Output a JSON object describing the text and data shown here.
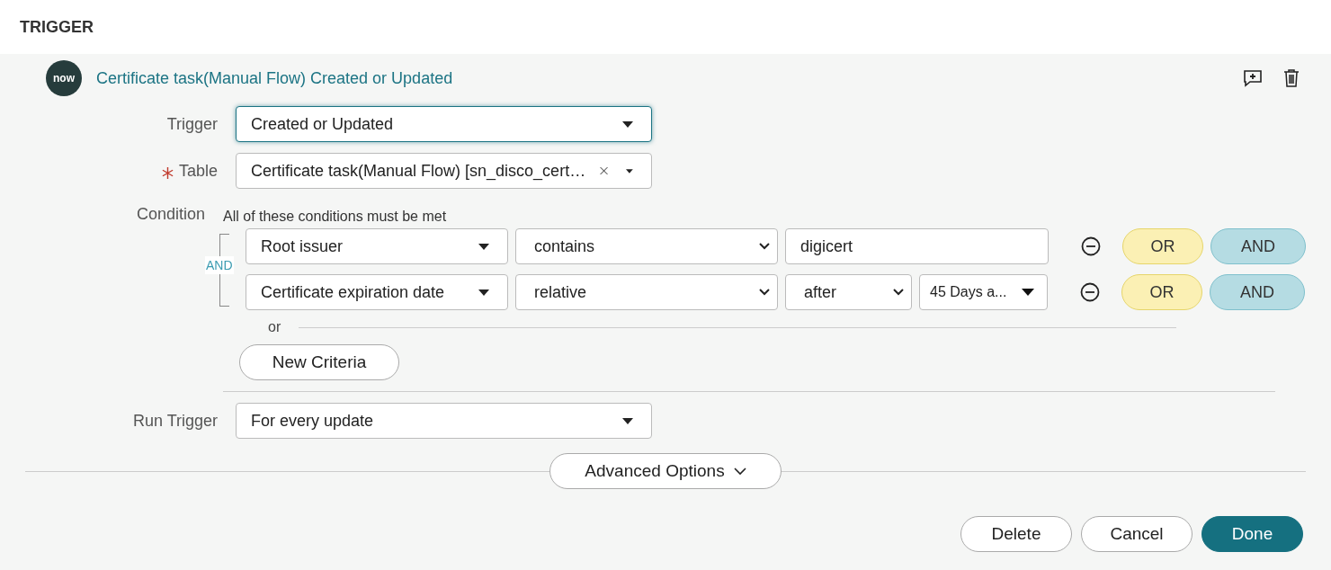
{
  "header": {
    "title": "TRIGGER"
  },
  "trigger_card": {
    "title": "Certificate task(Manual Flow) Created or Updated",
    "logo": "now"
  },
  "fields": [
    {
      "label": "Trigger",
      "required": false,
      "value": "Created or Updated",
      "focused": true,
      "clearable": false
    },
    {
      "label": "Table",
      "required": true,
      "value": "Certificate task(Manual Flow) [sn_disco_cert…",
      "focused": false,
      "clearable": true
    }
  ],
  "condition": {
    "label": "Condition",
    "hint": "All of these conditions must be met",
    "joiner": "AND",
    "rows": [
      {
        "cells": [
          {
            "kind": "field",
            "value": "Root issuer"
          },
          {
            "kind": "select",
            "value": "contains"
          },
          {
            "kind": "input",
            "value": "digicert"
          }
        ],
        "or_label": "OR",
        "and_label": "AND"
      },
      {
        "cells": [
          {
            "kind": "field",
            "value": "Certificate expiration date"
          },
          {
            "kind": "select",
            "value": "relative"
          },
          {
            "kind": "small-select",
            "value": "after"
          },
          {
            "kind": "small-field",
            "value": "45 Days a..."
          }
        ],
        "or_label": "OR",
        "and_label": "AND"
      }
    ],
    "or_separator": "or",
    "new_criteria": "New Criteria"
  },
  "run_trigger": {
    "label": "Run Trigger",
    "value": "For every update"
  },
  "advanced_options": {
    "label": "Advanced Options",
    "expanded": false
  },
  "buttons": [
    {
      "label": "Delete",
      "kind": "secondary"
    },
    {
      "label": "Cancel",
      "kind": "secondary"
    },
    {
      "label": "Done",
      "kind": "primary"
    }
  ]
}
